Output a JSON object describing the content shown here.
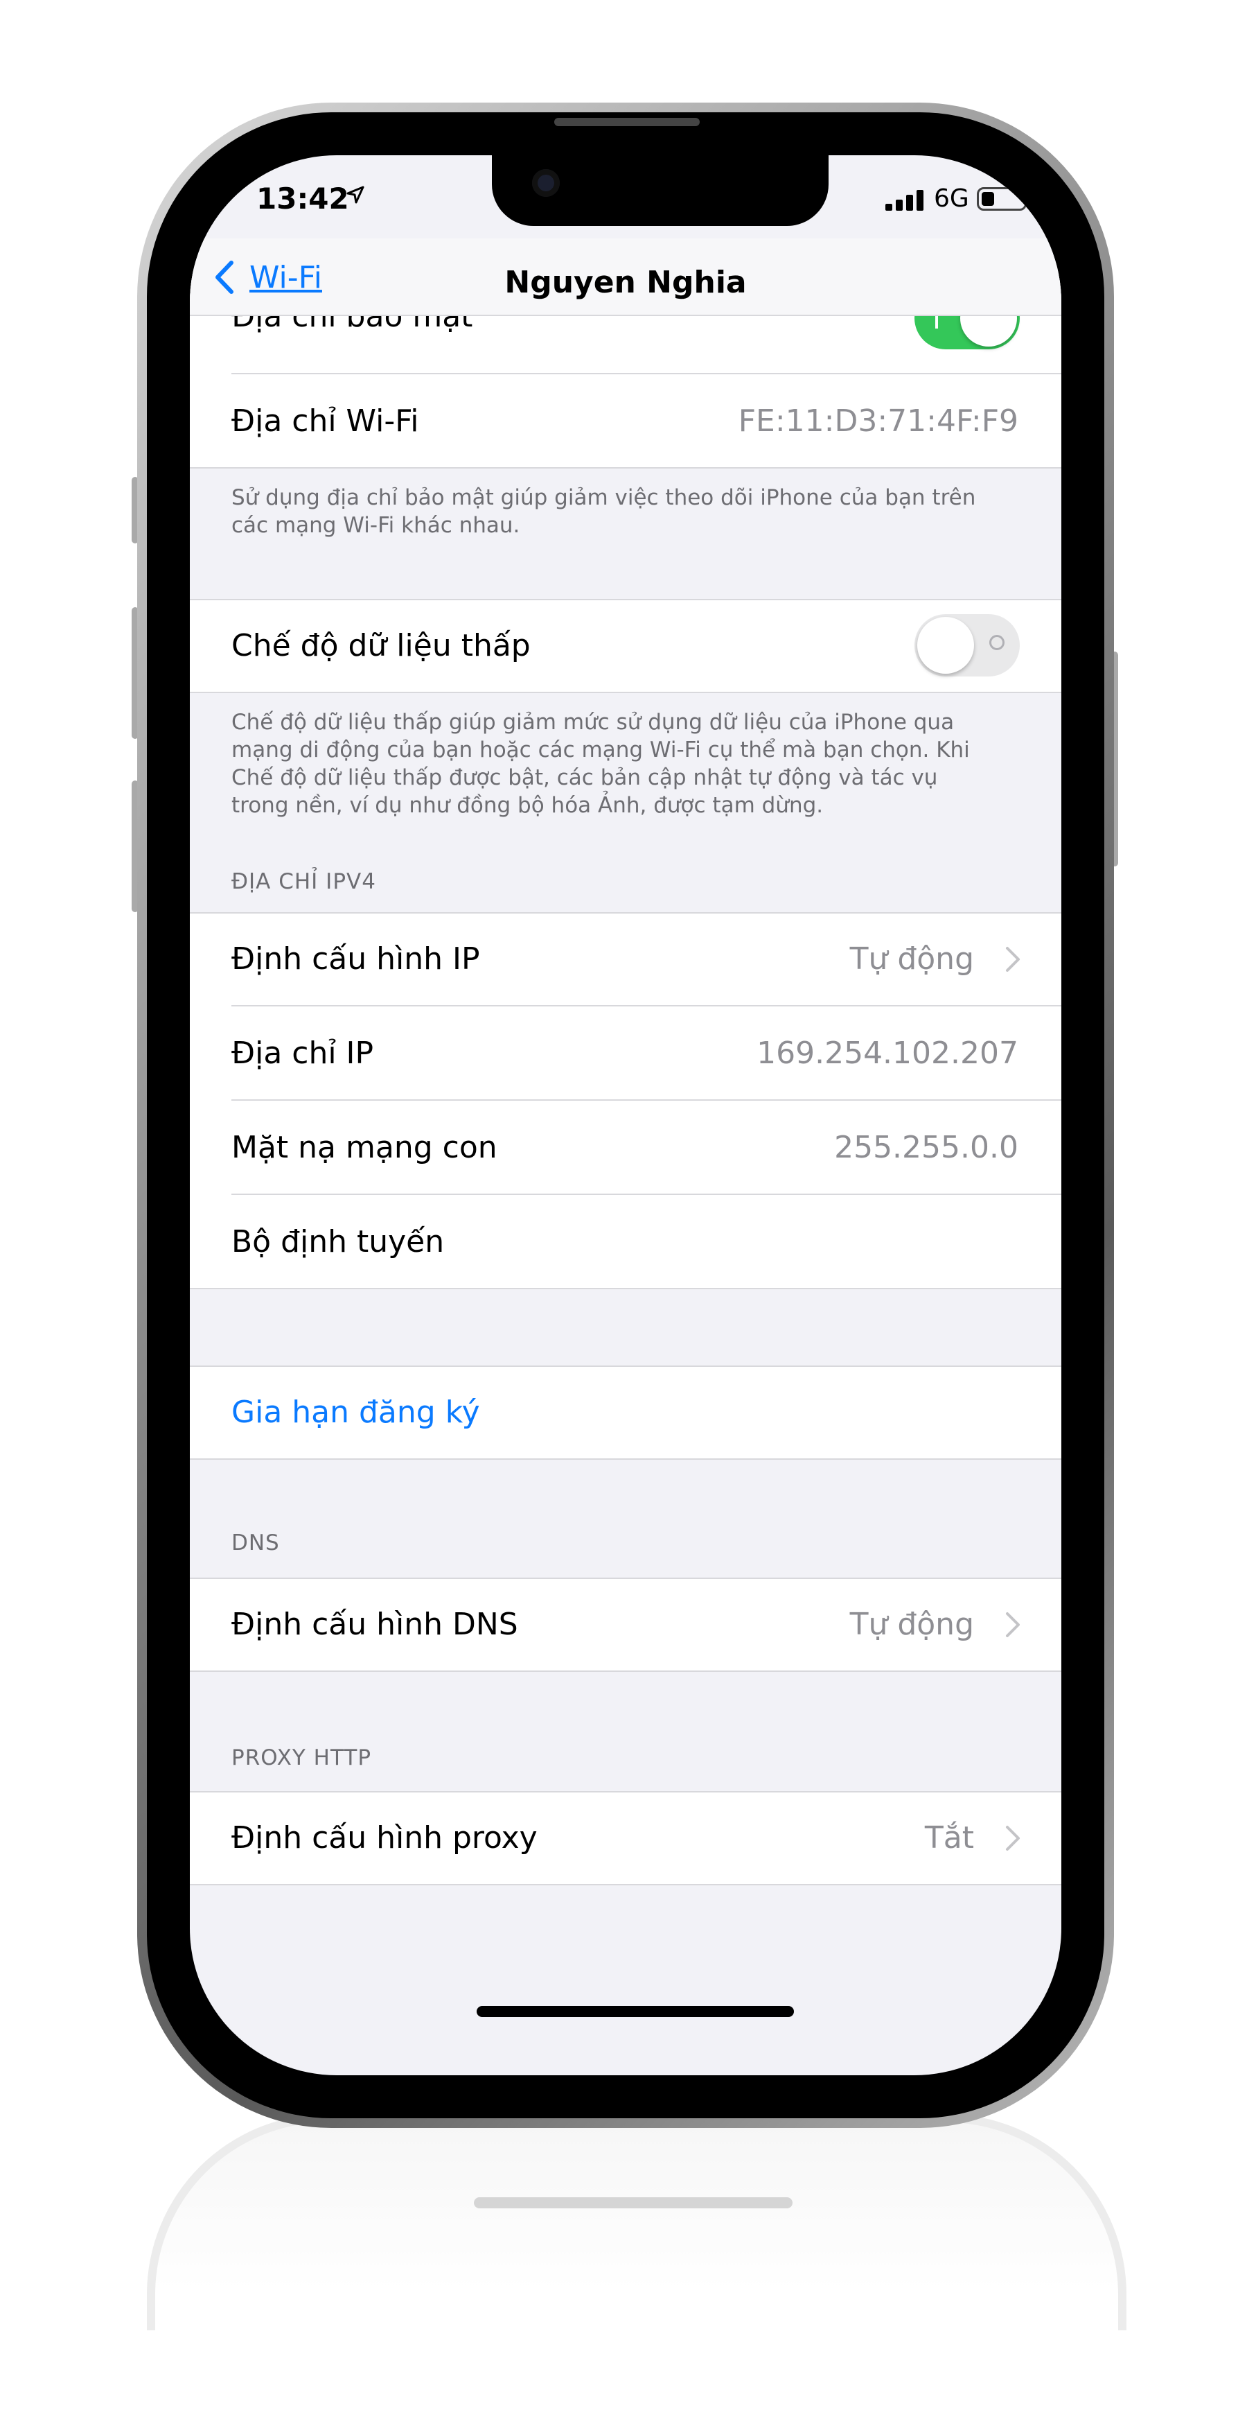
{
  "status_bar": {
    "time": "13:42",
    "network": "6G"
  },
  "nav": {
    "back_label": "Wi-Fi",
    "title": "Nguyen Nghia"
  },
  "rows": {
    "secure_address": {
      "label": "Địa chỉ bảo mật",
      "toggle_on": true
    },
    "wifi_address": {
      "label": "Địa chỉ Wi-Fi",
      "value": "FE:11:D3:71:4F:F9"
    },
    "low_data_mode": {
      "label": "Chế độ dữ liệu thấp",
      "toggle_on": false
    },
    "configure_ip": {
      "label": "Định cấu hình IP",
      "value": "Tự động"
    },
    "ip_address": {
      "label": "Địa chỉ IP",
      "value": "169.254.102.207"
    },
    "subnet_mask": {
      "label": "Mặt nạ mạng con",
      "value": "255.255.0.0"
    },
    "router": {
      "label": "Bộ định tuyến",
      "value": ""
    },
    "renew_lease": {
      "label": "Gia hạn đăng ký"
    },
    "configure_dns": {
      "label": "Định cấu hình DNS",
      "value": "Tự động"
    },
    "configure_proxy": {
      "label": "Định cấu hình proxy",
      "value": "Tắt"
    }
  },
  "footers": {
    "secure_address": "Sử dụng địa chỉ bảo mật giúp giảm việc theo dõi iPhone của bạn trên các mạng Wi-Fi khác nhau.",
    "low_data_mode": "Chế độ dữ liệu thấp giúp giảm mức sử dụng dữ liệu của iPhone qua mạng di động của bạn hoặc các mạng Wi-Fi cụ thể mà bạn chọn. Khi Chế độ dữ liệu thấp được bật, các bản cập nhật tự động và tác vụ trong nền, ví dụ như đồng bộ hóa Ảnh, được tạm dừng."
  },
  "headers": {
    "ipv4": "ĐỊA CHỈ IPV4",
    "dns": "DNS",
    "proxy": "PROXY HTTP"
  },
  "colors": {
    "accent": "#0a7aff",
    "toggle_on": "#34c759",
    "background": "#f2f2f7"
  },
  "icons": [
    "location-arrow-icon",
    "signal-bars-icon",
    "battery-icon",
    "chevron-left-icon",
    "chevron-right-icon"
  ]
}
